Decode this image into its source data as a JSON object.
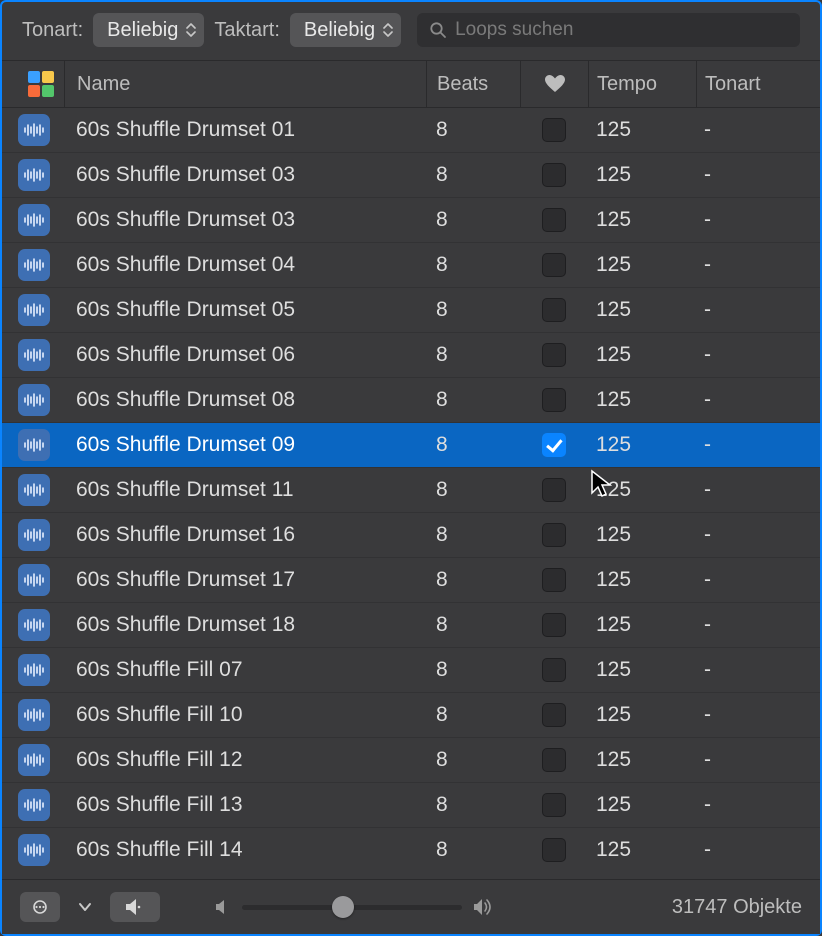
{
  "toolbar": {
    "tonart_label": "Tonart:",
    "tonart_value": "Beliebig",
    "taktart_label": "Taktart:",
    "taktart_value": "Beliebig",
    "search_placeholder": "Loops suchen"
  },
  "columns": {
    "name": "Name",
    "beats": "Beats",
    "tempo": "Tempo",
    "tonart": "Tonart"
  },
  "rows": [
    {
      "name": "60s Shuffle Drumset 01",
      "beats": "8",
      "fav": false,
      "tempo": "125",
      "tonart": "-",
      "selected": false
    },
    {
      "name": "60s Shuffle Drumset 03",
      "beats": "8",
      "fav": false,
      "tempo": "125",
      "tonart": "-",
      "selected": false
    },
    {
      "name": "60s Shuffle Drumset 03",
      "beats": "8",
      "fav": false,
      "tempo": "125",
      "tonart": "-",
      "selected": false
    },
    {
      "name": "60s Shuffle Drumset 04",
      "beats": "8",
      "fav": false,
      "tempo": "125",
      "tonart": "-",
      "selected": false
    },
    {
      "name": "60s Shuffle Drumset 05",
      "beats": "8",
      "fav": false,
      "tempo": "125",
      "tonart": "-",
      "selected": false
    },
    {
      "name": "60s Shuffle Drumset 06",
      "beats": "8",
      "fav": false,
      "tempo": "125",
      "tonart": "-",
      "selected": false
    },
    {
      "name": "60s Shuffle Drumset 08",
      "beats": "8",
      "fav": false,
      "tempo": "125",
      "tonart": "-",
      "selected": false
    },
    {
      "name": "60s Shuffle Drumset 09",
      "beats": "8",
      "fav": true,
      "tempo": "125",
      "tonart": "-",
      "selected": true
    },
    {
      "name": "60s Shuffle Drumset 11",
      "beats": "8",
      "fav": false,
      "tempo": "125",
      "tonart": "-",
      "selected": false
    },
    {
      "name": "60s Shuffle Drumset 16",
      "beats": "8",
      "fav": false,
      "tempo": "125",
      "tonart": "-",
      "selected": false
    },
    {
      "name": "60s Shuffle Drumset 17",
      "beats": "8",
      "fav": false,
      "tempo": "125",
      "tonart": "-",
      "selected": false
    },
    {
      "name": "60s Shuffle Drumset 18",
      "beats": "8",
      "fav": false,
      "tempo": "125",
      "tonart": "-",
      "selected": false
    },
    {
      "name": "60s Shuffle Fill 07",
      "beats": "8",
      "fav": false,
      "tempo": "125",
      "tonart": "-",
      "selected": false
    },
    {
      "name": "60s Shuffle Fill 10",
      "beats": "8",
      "fav": false,
      "tempo": "125",
      "tonart": "-",
      "selected": false
    },
    {
      "name": "60s Shuffle Fill 12",
      "beats": "8",
      "fav": false,
      "tempo": "125",
      "tonart": "-",
      "selected": false
    },
    {
      "name": "60s Shuffle Fill 13",
      "beats": "8",
      "fav": false,
      "tempo": "125",
      "tonart": "-",
      "selected": false
    },
    {
      "name": "60s Shuffle Fill 14",
      "beats": "8",
      "fav": false,
      "tempo": "125",
      "tonart": "-",
      "selected": false
    }
  ],
  "footer": {
    "object_count": "31747 Objekte",
    "volume_pct": 46
  }
}
